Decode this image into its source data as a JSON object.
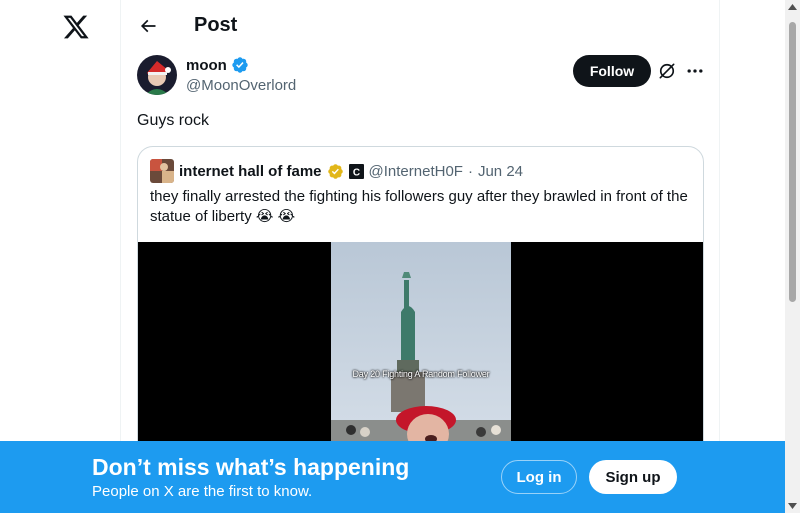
{
  "header": {
    "title": "Post"
  },
  "post": {
    "author_name": "moon",
    "author_handle": "@MoonOverlord",
    "follow_label": "Follow",
    "text": "Guys rock"
  },
  "quote": {
    "author_name": "internet hall of fame",
    "badge_letter": "C",
    "author_handle": "@InternetH0F",
    "dot": "·",
    "date": "Jun 24",
    "text": "they finally arrested the fighting his followers guy after they brawled in front of the statue of liberty",
    "emoji_1": "😭",
    "emoji_2": "😭",
    "video_caption": "Day 20 Fighting A Random Follower"
  },
  "banner": {
    "title": "Don’t miss what’s happening",
    "subtitle": "People on X are the first to know.",
    "login_label": "Log in",
    "signup_label": "Sign up"
  },
  "colors": {
    "accent": "#1d9bf0",
    "verified_blue": "#1d9bf0",
    "verified_gold": "#e2b719",
    "text": "#0f1419",
    "muted": "#536471"
  }
}
